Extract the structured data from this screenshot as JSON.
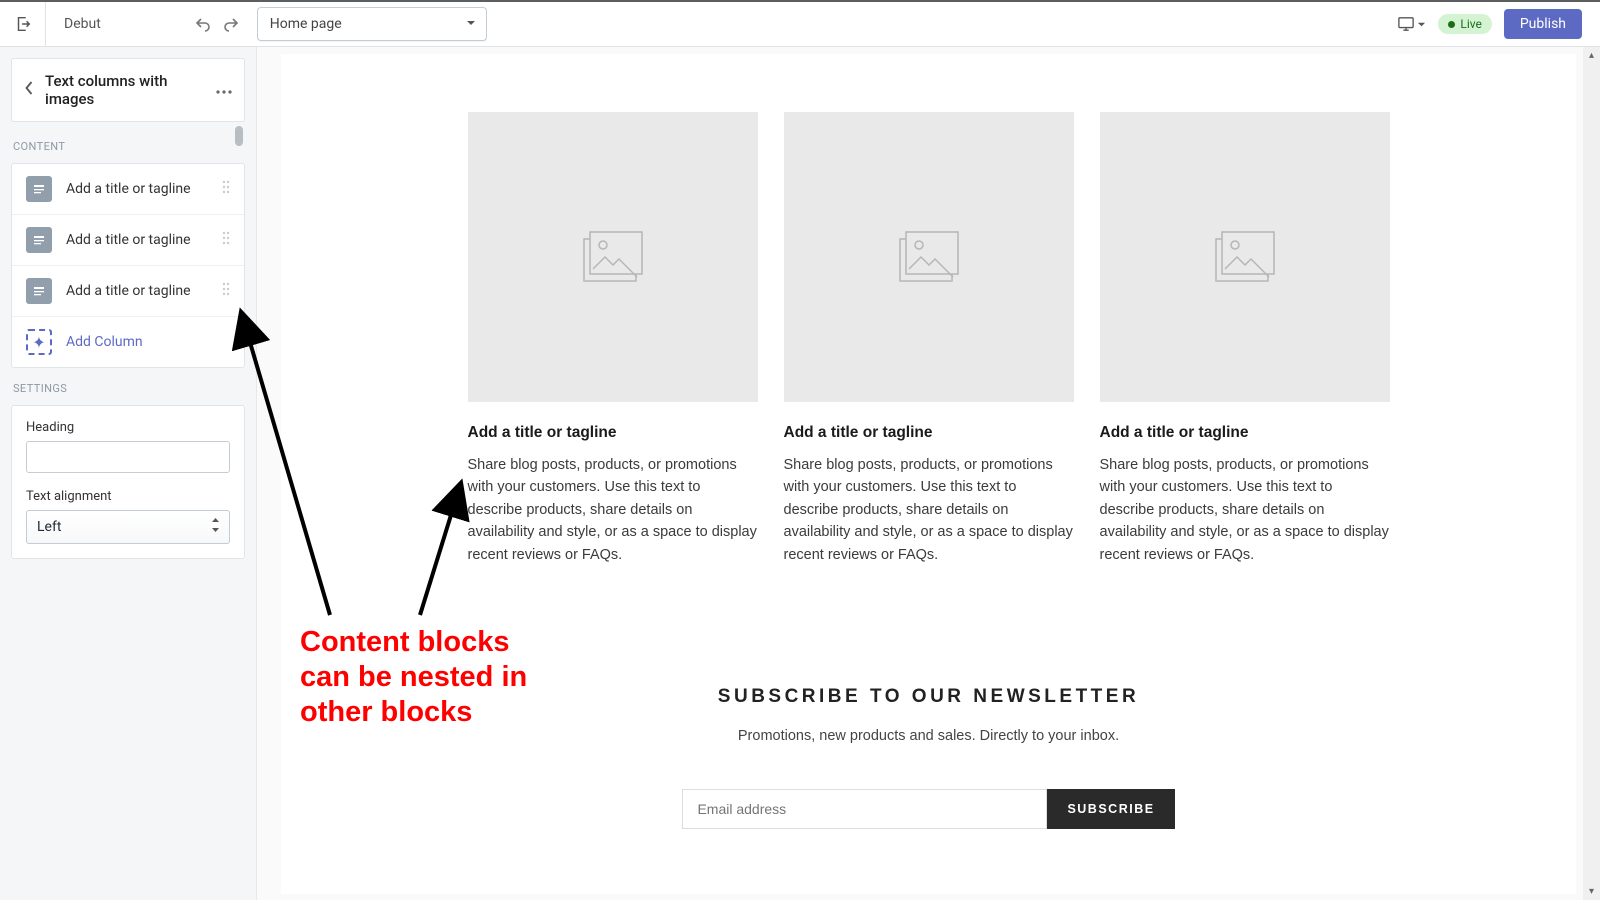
{
  "topbar": {
    "theme_name": "Debut",
    "page_selector": "Home page",
    "live_label": "Live",
    "publish_label": "Publish"
  },
  "sidebar": {
    "section_title": "Text columns with images",
    "content_label": "CONTENT",
    "items": [
      {
        "label": "Add a title or tagline"
      },
      {
        "label": "Add a title or tagline"
      },
      {
        "label": "Add a title or tagline"
      }
    ],
    "add_column_label": "Add Column",
    "settings_label": "SETTINGS",
    "heading_field_label": "Heading",
    "heading_value": "",
    "alignment_field_label": "Text alignment",
    "alignment_value": "Left"
  },
  "preview": {
    "columns": [
      {
        "title": "Add a title or tagline",
        "text": "Share blog posts, products, or promotions with your customers. Use this text to describe products, share details on availability and style, or as a space to display recent reviews or FAQs."
      },
      {
        "title": "Add a title or tagline",
        "text": "Share blog posts, products, or promotions with your customers. Use this text to describe products, share details on availability and style, or as a space to display recent reviews or FAQs."
      },
      {
        "title": "Add a title or tagline",
        "text": "Share blog posts, products, or promotions with your customers. Use this text to describe products, share details on availability and style, or as a space to display recent reviews or FAQs."
      }
    ],
    "newsletter": {
      "title": "SUBSCRIBE TO OUR NEWSLETTER",
      "subtitle": "Promotions, new products and sales. Directly to your inbox.",
      "placeholder": "Email address",
      "button": "SUBSCRIBE"
    }
  },
  "annotation": {
    "text": "Content blocks can be nested in other blocks"
  }
}
